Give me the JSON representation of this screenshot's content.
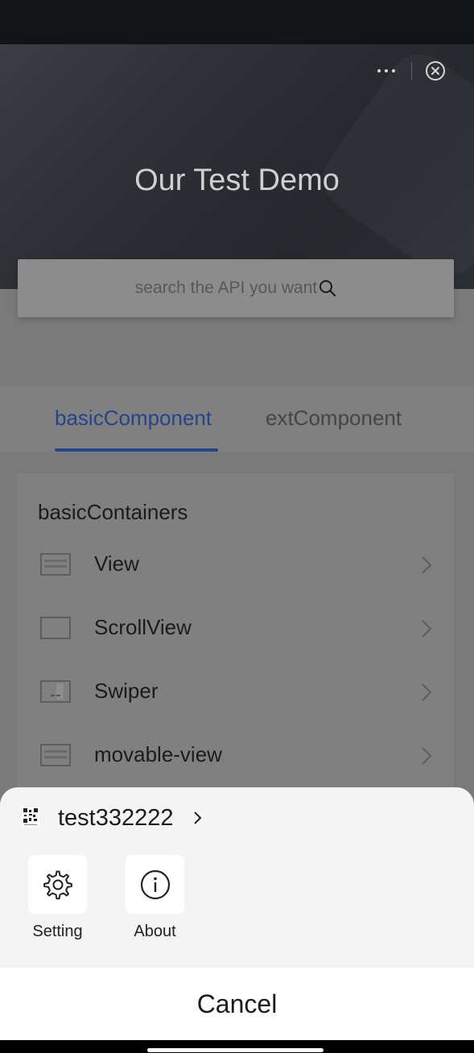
{
  "header": {
    "title": "Our Test Demo",
    "more_label": "more",
    "close_label": "close"
  },
  "search": {
    "placeholder": "search the API you want"
  },
  "tabs": [
    {
      "label": "basicComponent",
      "active": true
    },
    {
      "label": "extComponent",
      "active": false
    }
  ],
  "list": {
    "section_title": "basicContainers",
    "items": [
      {
        "label": "View",
        "icon": "view-icon"
      },
      {
        "label": "ScrollView",
        "icon": "scrollview-icon"
      },
      {
        "label": "Swiper",
        "icon": "swiper-icon"
      },
      {
        "label": "movable-view",
        "icon": "movable-view-icon"
      }
    ]
  },
  "sheet": {
    "app_name": "test332222",
    "actions": [
      {
        "label": "Setting",
        "icon": "gear-icon"
      },
      {
        "label": "About",
        "icon": "info-icon"
      }
    ],
    "cancel_label": "Cancel"
  },
  "colors": {
    "accent": "#23448a",
    "sheet_bg": "#f4f4f4",
    "header_bg": "#2b2e33"
  }
}
